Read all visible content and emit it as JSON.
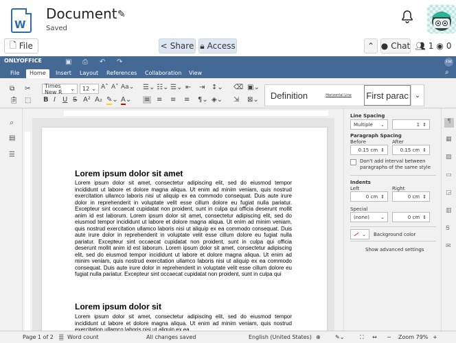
{
  "header": {
    "doc_title": "Document",
    "saved_status": "Saved",
    "file_button": "File",
    "share_button": "Share",
    "access_button": "Access",
    "chat_button": "Chat",
    "users_count": "1",
    "viewers_count": "0"
  },
  "app": {
    "logo": "ONLYOFFICE",
    "avatar_initials": "FM",
    "menu_tabs": [
      "File",
      "Home",
      "Insert",
      "Layout",
      "References",
      "Collaboration",
      "View"
    ],
    "active_tab": "Home"
  },
  "toolbar": {
    "font_name": "Times New R",
    "font_size": "12",
    "styles": [
      "Definition",
      "Horizontal Line",
      "First parac"
    ]
  },
  "document": {
    "heading1": "Lorem ipsum dolor sit amet",
    "para1": "Lorem ipsum dolor sit amet, consectetur adipiscing elit, sed do eiusmod tempor incididunt ut labore et dolore magna aliqua. Ut enim ad minim veniam, quis nostrud exercitation ullamco laboris nisi ut aliquip ex ea commodo consequat. Duis aute irure dolor in reprehenderit in voluptate velit esse cillum dolore eu fugiat nulla pariatur. Excepteur sint occaecat cupidatat non proident, sunt in culpa qui officia deserunt mollit anim id est laborum. Lorem ipsum dolor sit amet, consectetur adipiscing elit, sed do eiusmod tempor incididunt ut labore et dolore magna aliqua. Ut enim ad minim veniam, quis nostrud exercitation ullamco laboris nisi ut aliquip ex ea commodo consequat. Duis aute irure dolor in reprehenderit in voluptate velit esse cillum dolore eu fugiat nulla pariatur. Excepteur sint occaecat cupidatat non proident, sunt in culpa qui officia deserunt mollit anim id est laborum. Lorem ipsum dolor sit amet, consectetur adipiscing elit, sed do eiusmod tempor incididunt ut labore et dolore magna aliqua. Ut enim ad minim veniam, quis nostrud exercitation ullamco laboris nisi ut aliquip ex ea commodo consequat. Duis aute irure dolor in reprehenderit in voluptate velit esse cillum dolore eu fugiat nulla pariatur. Excepteur sint occaecat cupidatat non proident, sunt in culpa qui",
    "heading2": "Lorem ipsum dolor sit",
    "para2": "Lorem ipsum dolor sit amet, consectetur adipiscing elit, sed do eiusmod tempor incididunt ut labore et dolore magna aliqua. Ut enim ad minim veniam, quis nostrud exercitation ullamco laboris nisi ut aliquip ex ea"
  },
  "settings": {
    "line_spacing_label": "Line Spacing",
    "line_spacing_mode": "Multiple",
    "line_spacing_value": "1",
    "paragraph_spacing_label": "Paragraph Spacing",
    "before_label": "Before",
    "before_value": "0.15 cm",
    "after_label": "After",
    "after_value": "0.15 cm",
    "dont_add_interval": "Don't add interval between paragraphs of the same style",
    "indents_label": "Indents",
    "left_label": "Left",
    "left_value": "0 cm",
    "right_label": "Right",
    "right_value": "0 cm",
    "special_label": "Special",
    "special_value": "(none)",
    "special_amount": "0 cm",
    "background_color": "Background color",
    "advanced": "Show advanced settings"
  },
  "status": {
    "page": "Page 1 of 2",
    "word_count": "Word count",
    "changes": "All changes saved",
    "language": "English (United States)",
    "zoom": "Zoom 79%"
  },
  "colors": {
    "appbar": "#446995",
    "accent": "#2b6cb0"
  }
}
